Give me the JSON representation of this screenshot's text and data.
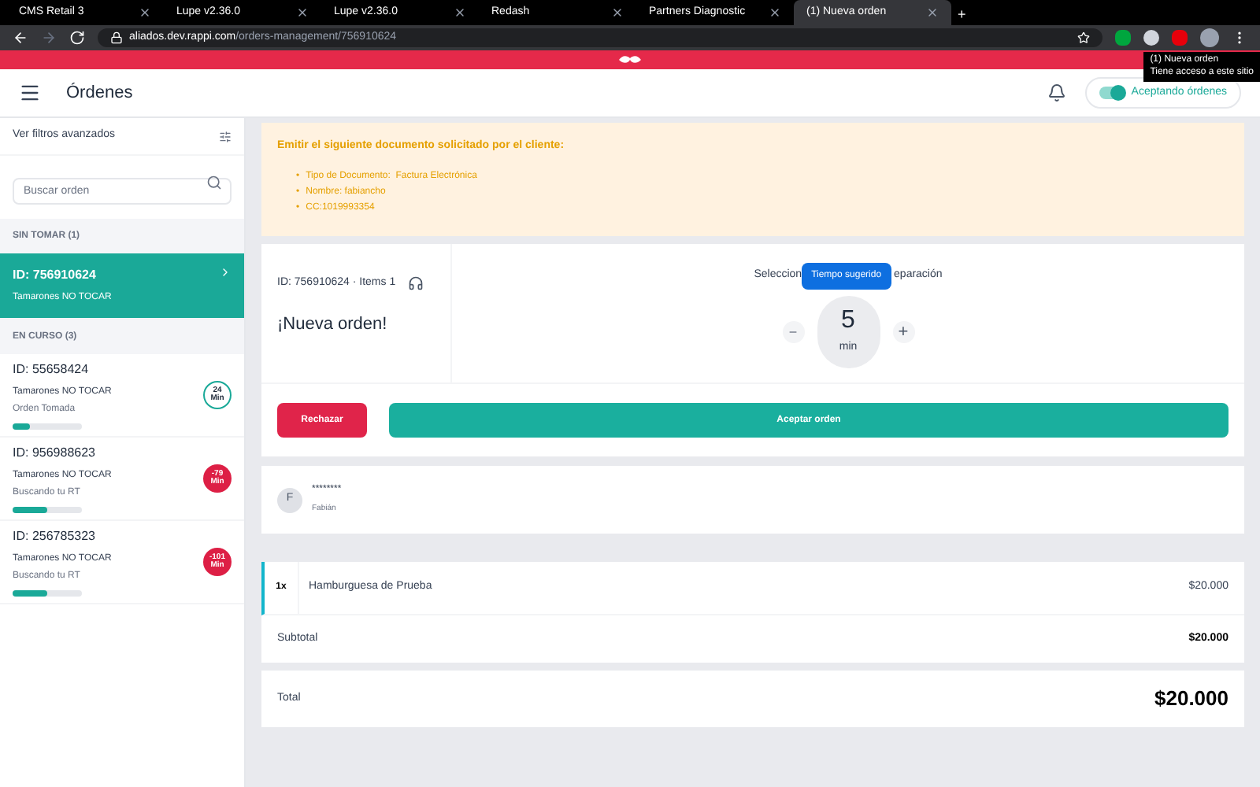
{
  "browser": {
    "tabs": [
      {
        "title": "CMS Retail 3",
        "selected": false
      },
      {
        "title": "Lupe v2.36.0",
        "selected": false
      },
      {
        "title": "Lupe v2.36.0",
        "selected": false
      },
      {
        "title": "Redash",
        "selected": false
      },
      {
        "title": "Partners Diagnostic",
        "selected": false
      },
      {
        "title": "(1) Nueva orden",
        "selected": true
      }
    ],
    "new_tab": "+",
    "url_host": "aliados.dev.rappi.com",
    "url_path": "/orders-management/756910624",
    "tooltip": {
      "title": "(1) Nueva orden",
      "text": "Tiene acceso a este sitio"
    }
  },
  "header": {
    "title": "Órdenes",
    "toggle_label": "Aceptando órdenes",
    "toggle_on": true
  },
  "sidebar": {
    "filters": "Ver filtros avanzados",
    "search_placeholder": "Buscar orden",
    "sections": [
      {
        "title": "SIN TOMAR (1)",
        "orders": [
          {
            "id": "ID: 756910624",
            "store": "Tamarones NO TOCAR",
            "selected": true
          }
        ]
      },
      {
        "title": "EN CURSO (3)",
        "orders": [
          {
            "id": "ID: 55658424",
            "store": "Tamarones NO TOCAR",
            "status": "Orden Tomada",
            "level": 0.25,
            "timer": "24",
            "timer_unit": "Min",
            "kind": "ontime",
            "selected": false
          },
          {
            "id": "ID: 956988623",
            "store": "Tamarones NO TOCAR",
            "status": "Buscando tu RT",
            "level": 0.5,
            "timer": "-79",
            "timer_unit": "Min",
            "kind": "late",
            "selected": false
          },
          {
            "id": "ID: 256785323",
            "store": "Tamarones NO TOCAR",
            "status": "Buscando tu RT",
            "level": 0.5,
            "timer": "-101",
            "timer_unit": "Min",
            "kind": "late",
            "selected": false
          }
        ]
      }
    ]
  },
  "notice": {
    "bullet": "•",
    "title": "Emitir el siguiente documento solicitado por el cliente:",
    "items": [
      "Tipo de Documento:  Factura Electrónica",
      "Nombre: fabiancho",
      "CC:1019993354"
    ]
  },
  "order": {
    "meta": "ID: 756910624 · Items 1",
    "headline": "¡Nueva orden!",
    "prep_label_left": "Seleccion",
    "prep_label_right": "eparación",
    "tooltip": "Tiempo sugerido",
    "minus": "−",
    "plus": "+",
    "minutes": "5",
    "unit": "min",
    "reject": "Rechazar",
    "accept": "Aceptar orden"
  },
  "customer": {
    "initial": "F",
    "masked": "********",
    "name": "Fabián"
  },
  "items": [
    {
      "qty": "1x",
      "name": "Hamburguesa de Prueba",
      "price": "$20.000"
    }
  ],
  "subtotal": {
    "label": "Subtotal",
    "value": "$20.000"
  },
  "total": {
    "label": "Total",
    "value": "$20.000"
  }
}
